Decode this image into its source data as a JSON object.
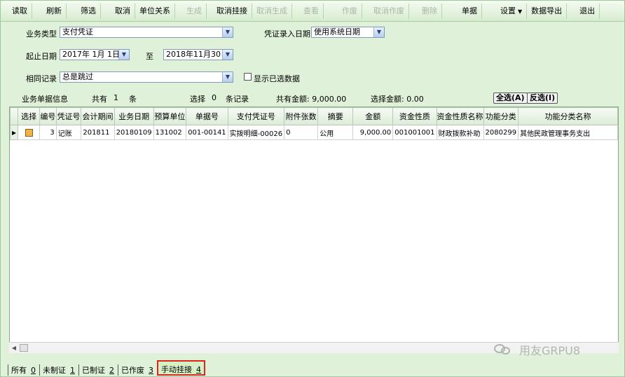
{
  "toolbar": {
    "items": [
      {
        "label": "读取",
        "enabled": true
      },
      {
        "label": "刷新",
        "enabled": true
      },
      {
        "label": "筛选",
        "enabled": true
      },
      {
        "label": "取消",
        "enabled": true
      },
      {
        "label": "单位关系",
        "enabled": true
      },
      {
        "label": "生成",
        "enabled": false
      },
      {
        "label": "取消挂接",
        "enabled": true
      },
      {
        "label": "取消生成",
        "enabled": false
      },
      {
        "label": "查看",
        "enabled": false
      },
      {
        "label": "作废",
        "enabled": false
      },
      {
        "label": "取消作废",
        "enabled": false
      },
      {
        "label": "删除",
        "enabled": false
      },
      {
        "label": "单据",
        "enabled": true
      },
      {
        "label": "设置",
        "enabled": true
      },
      {
        "label": "数据导出",
        "enabled": true
      },
      {
        "label": "退出",
        "enabled": true
      }
    ]
  },
  "filters": {
    "biz_type_label": "业务类型",
    "biz_type_value": "支付凭证",
    "voucher_date_label": "凭证录入日期",
    "voucher_date_value": "使用系统日期",
    "date_range_label": "起止日期",
    "start_date": "2017年 1月 1日",
    "to_label": "至",
    "end_date": "2018年11月30日",
    "same_record_label": "相同记录",
    "same_record_value": "总是跳过",
    "show_selected_label": "显示已选数据"
  },
  "summary": {
    "info_label": "业务单据信息",
    "total_prefix": "共有",
    "total_count": "1",
    "total_suffix": "条",
    "selected_prefix": "选择",
    "selected_count": "0",
    "selected_suffix": "条记录",
    "total_amount_label": "共有金额: 9,000.00",
    "selected_amount_label": "选择金额: 0.00",
    "select_all": "全选(A)",
    "invert_select": "反选(I)"
  },
  "table": {
    "columns": [
      "选择",
      "编号",
      "凭证号",
      "会计期间",
      "业务日期",
      "预算单位",
      "单据号",
      "支付凭证号",
      "附件张数",
      "摘要",
      "金额",
      "资金性质",
      "资金性质名称",
      "功能分类",
      "功能分类名称"
    ],
    "rows": [
      {
        "no": "3",
        "voucher": "记账",
        "period": "201811",
        "biz_date": "20180109",
        "unit": "131002",
        "doc_no": "001-00141",
        "pay_voucher": "实拨明细-00026",
        "attachments": "0",
        "summary": "公用",
        "amount": "9,000.00",
        "fund_type": "001001001",
        "fund_type_name": "财政拨款补助",
        "func_class": "2080299",
        "func_class_name": "其他民政管理事务支出"
      }
    ]
  },
  "tabs": [
    {
      "label": "所有",
      "count": "0"
    },
    {
      "label": "未制证",
      "count": "1"
    },
    {
      "label": "已制证",
      "count": "2"
    },
    {
      "label": "已作废",
      "count": "3"
    },
    {
      "label": "手动挂接",
      "count": "4",
      "active": true
    }
  ],
  "watermark": {
    "text": "用友GRPU8"
  },
  "colors": {
    "window_bg": "#dff1d8",
    "highlight": "#d9261c",
    "check_fill": "#f7b046"
  }
}
